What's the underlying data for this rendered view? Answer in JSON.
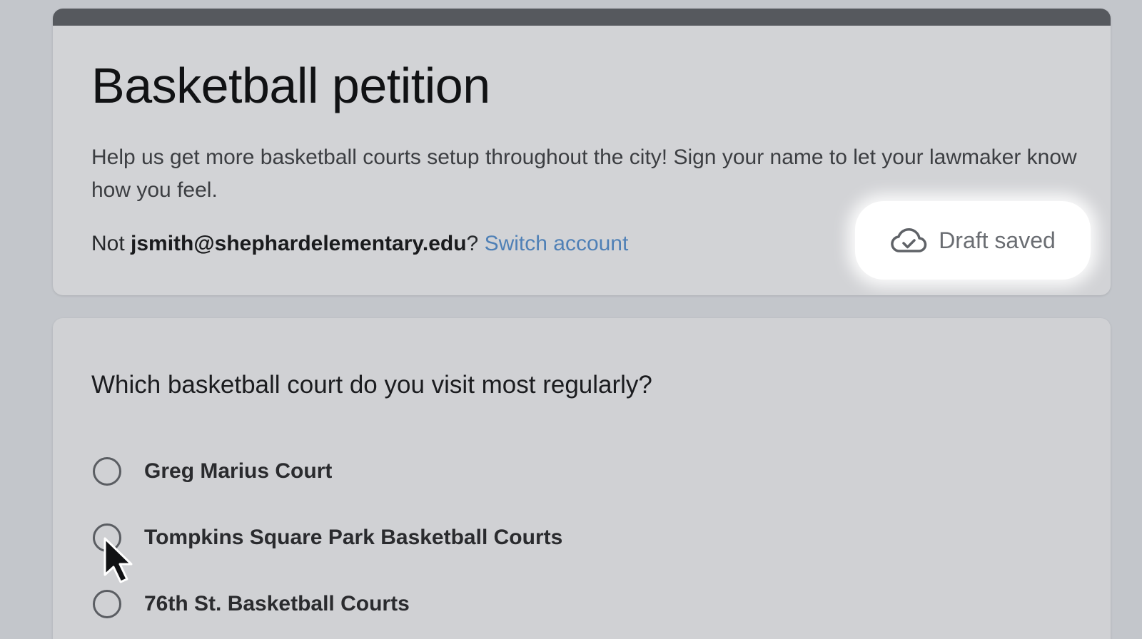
{
  "form": {
    "title": "Basketball petition",
    "description": "Help us get more basketball courts setup throughout the city! Sign your name to let your lawmaker know how you feel.",
    "account": {
      "prefix": "Not ",
      "email": "jsmith@shephardelementary.edu",
      "suffix": "? ",
      "switch_label": "Switch account"
    },
    "draft_status": {
      "icon": "cloud-check-icon",
      "label": "Draft saved"
    }
  },
  "question": {
    "title": "Which basketball court do you visit most regularly?",
    "options": [
      {
        "label": "Greg Marius Court"
      },
      {
        "label": "Tompkins Square Park Basketball Courts"
      },
      {
        "label": "76th St. Basketball Courts"
      }
    ]
  },
  "colors": {
    "background": "#c3c6cb",
    "card": "#d2d3d6",
    "header_stripe": "#56595e",
    "link": "#4f80b6"
  },
  "cursor": {
    "icon": "mouse-pointer-icon"
  }
}
